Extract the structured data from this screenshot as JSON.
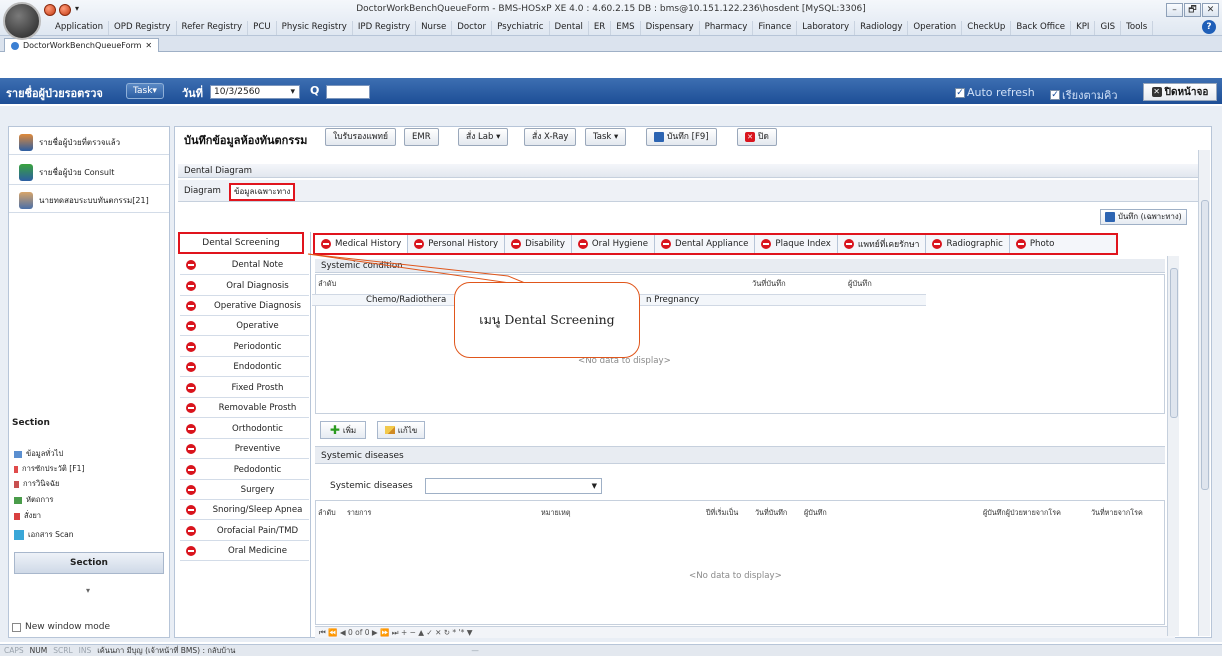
{
  "window": {
    "title": "DoctorWorkBenchQueueForm - BMS-HOSxP XE 4.0 : 4.60.2.15 DB : bms@10.151.122.236\\hosdent [MySQL:3306]",
    "controls": [
      "–",
      "🗗",
      "✕"
    ]
  },
  "menu": [
    "Application",
    "OPD Registry",
    "Refer Registry",
    "PCU",
    "Physic Registry",
    "IPD Registry",
    "Nurse",
    "Doctor",
    "Psychiatric",
    "Dental",
    "ER",
    "EMS",
    "Dispensary",
    "Pharmacy",
    "Finance",
    "Laboratory",
    "Radiology",
    "Operation",
    "CheckUp",
    "Back Office",
    "KPI",
    "GIS",
    "Tools"
  ],
  "doc_tab": "DoctorWorkBenchQueueForm",
  "queue_bar": {
    "title": "รายชื่อผู้ป่วยรอตรวจ",
    "task": "Task▾",
    "date_label": "วันที่",
    "date_value": "10/3/2560",
    "q_label": "Q",
    "auto_refresh": "Auto refresh",
    "sort_queue": "เรียงตามคิว",
    "close_screen": "ปิดหน้าจอ"
  },
  "left_pane": {
    "items": [
      "รายชื่อผู้ป่วยที่ตรวจแล้ว",
      "รายชื่อผู้ป่วย Consult",
      "นายทดสอบระบบทันตกรรม[21]"
    ],
    "section_title": "Section",
    "section_items": [
      "ข้อมูลทั่วไป",
      "การซักประวัติ [F1]",
      "การวินิจฉัย",
      "หัตถการ",
      "สั่งยา",
      "เอกสาร Scan"
    ],
    "section_button": "Section",
    "new_window": "New window mode"
  },
  "toolbar": {
    "title": "บันทึกข้อมูลห้องทันตกรรม",
    "buttons": [
      "ใบรับรองแพทย์",
      "EMR",
      "สั่ง Lab ▾",
      "สั่ง X-Ray",
      "Task ▾",
      "บันทึก [F9]",
      "ปิด"
    ]
  },
  "dental": {
    "panel_title": "Dental Diagram",
    "tab_diagram": "Diagram",
    "tab_detail": "ข้อมูลเฉพาะทาง",
    "save_special": "บันทึก (เฉพาะทาง)",
    "screening_header": "Dental Screening",
    "screening_items": [
      "Dental Note",
      "Oral Diagnosis",
      "Operative Diagnosis",
      "Operative",
      "Periodontic",
      "Endodontic",
      "Fixed Prosth",
      "Removable Prosth",
      "Orthodontic",
      "Preventive",
      "Pedodontic",
      "Surgery",
      "Snoring/Sleep Apnea",
      "Orofacial Pain/TMD",
      "Oral Medicine"
    ],
    "history_tabs": [
      "Medical History",
      "Personal History",
      "Disability",
      "Oral Hygiene",
      "Dental Appliance",
      "Plaque Index",
      "แพทย์ที่เคยรักษา",
      "Radiographic",
      "Photo"
    ],
    "systemic_condition": {
      "header": "Systemic condition",
      "columns": [
        "ลำดับ",
        "วันที่บันทึก",
        "ผู้บันทึก"
      ],
      "row_left": "Chemo/Radiothera",
      "row_right": "n Pregnancy",
      "nodata": "<No data to display>",
      "add": "เพิ่ม",
      "edit": "แก้ไข"
    },
    "systemic_diseases": {
      "header": "Systemic diseases",
      "label": "Systemic diseases",
      "columns": [
        "ลำดับ",
        "รายการ",
        "หมายเหตุ",
        "ปีที่เริ่มเป็น",
        "วันที่บันทึก",
        "ผู้บันทึก",
        "ผู้บันทึกผู้ป่วยหายจากโรค",
        "วันที่หายจากโรค"
      ],
      "nodata": "<No data to display>",
      "pager": "⏮ ⏪ ◀ 0 of 0 ▶ ⏩ ⏭ + − ▲ ✓ ✕ ↻ * '* ▼"
    }
  },
  "callout": "เมนู Dental Screening",
  "status": [
    "CAPS",
    "NUM",
    "SCRL",
    "INS",
    "เค้นนภา มีบุญ (เจ้าหน้าที่ BMS) : กลับบ้าน",
    "—"
  ]
}
